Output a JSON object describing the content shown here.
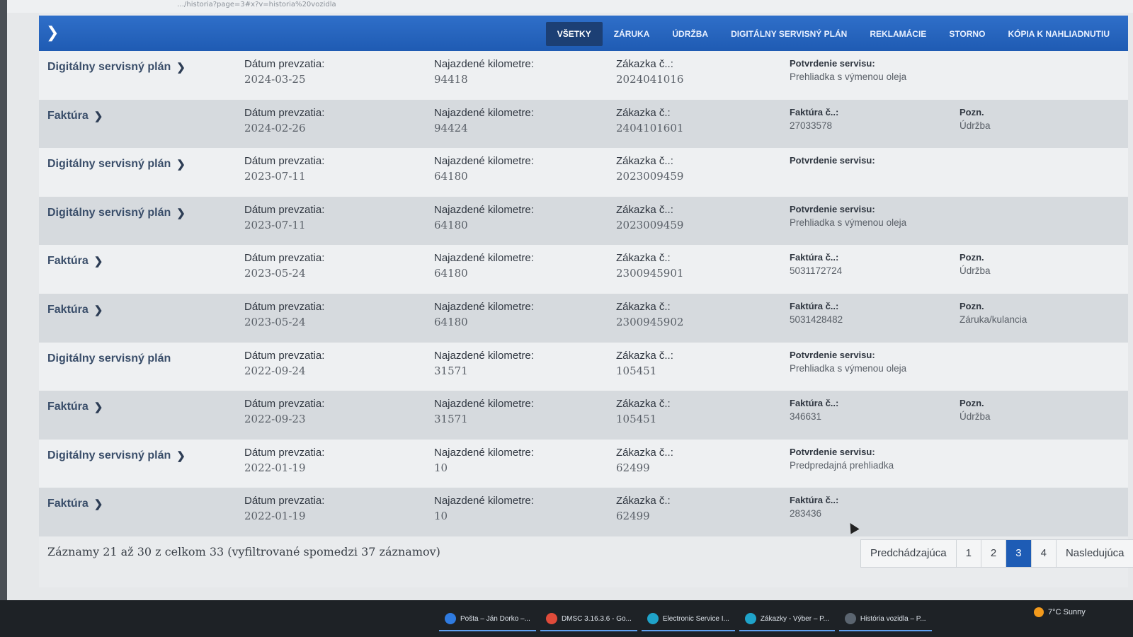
{
  "url": "…/historia?page=3#x?v=historia%20vozidla",
  "tabs": [
    "VŠETKY",
    "ZÁRUKA",
    "ÚDRŽBA",
    "DIGITÁLNY SERVISNÝ PLÁN",
    "REKLAMÁCIE",
    "STORNO",
    "KÓPIA K NAHLIADNUTIU"
  ],
  "labels": {
    "date": "Dátum prevzatia:",
    "km": "Najazdené kilometre:",
    "order": "Zákazka č.:",
    "order_alt": "Zákazka č..:",
    "confirm": "Potvrdenie servisu:",
    "invoice": "Faktúra č..:",
    "note": "Pozn."
  },
  "rows": [
    {
      "type": "Digitálny servisný plán",
      "chevron": true,
      "date": "2024-03-25",
      "km": "94418",
      "order_label": "Zákazka č..:",
      "order": "2024041016",
      "c4_label": "Potvrdenie servisu:",
      "c4_val": "Prehliadka s výmenou oleja",
      "note_label": "",
      "note": ""
    },
    {
      "type": "Faktúra",
      "chevron": true,
      "date": "2024-02-26",
      "km": "94424",
      "order_label": "Zákazka č.:",
      "order": "2404101601",
      "c4_label": "Faktúra č..:",
      "c4_val": "27033578",
      "note_label": "Pozn.",
      "note": "Údržba"
    },
    {
      "type": "Digitálny servisný plán",
      "chevron": true,
      "date": "2023-07-11",
      "km": "64180",
      "order_label": "Zákazka č..:",
      "order": "2023009459",
      "c4_label": "Potvrdenie servisu:",
      "c4_val": "",
      "note_label": "",
      "note": ""
    },
    {
      "type": "Digitálny servisný plán",
      "chevron": true,
      "date": "2023-07-11",
      "km": "64180",
      "order_label": "Zákazka č..:",
      "order": "2023009459",
      "c4_label": "Potvrdenie servisu:",
      "c4_val": "Prehliadka s výmenou oleja",
      "note_label": "",
      "note": ""
    },
    {
      "type": "Faktúra",
      "chevron": true,
      "date": "2023-05-24",
      "km": "64180",
      "order_label": "Zákazka č.:",
      "order": "2300945901",
      "c4_label": "Faktúra č..:",
      "c4_val": "5031172724",
      "note_label": "Pozn.",
      "note": "Údržba"
    },
    {
      "type": "Faktúra",
      "chevron": true,
      "date": "2023-05-24",
      "km": "64180",
      "order_label": "Zákazka č.:",
      "order": "2300945902",
      "c4_label": "Faktúra č..:",
      "c4_val": "5031428482",
      "note_label": "Pozn.",
      "note": "Záruka/kulancia"
    },
    {
      "type": "Digitálny servisný plán",
      "chevron": false,
      "date": "2022-09-24",
      "km": "31571",
      "order_label": "Zákazka č..:",
      "order": "105451",
      "c4_label": "Potvrdenie servisu:",
      "c4_val": "Prehliadka s výmenou oleja",
      "note_label": "",
      "note": ""
    },
    {
      "type": "Faktúra",
      "chevron": true,
      "date": "2022-09-23",
      "km": "31571",
      "order_label": "Zákazka č.:",
      "order": "105451",
      "c4_label": "Faktúra č..:",
      "c4_val": "346631",
      "note_label": "Pozn.",
      "note": "Údržba"
    },
    {
      "type": "Digitálny servisný plán",
      "chevron": true,
      "date": "2022-01-19",
      "km": "10",
      "order_label": "Zákazka č..:",
      "order": "62499",
      "c4_label": "Potvrdenie servisu:",
      "c4_val": "Predpredajná prehliadka",
      "note_label": "",
      "note": ""
    },
    {
      "type": "Faktúra",
      "chevron": true,
      "date": "2022-01-19",
      "km": "10",
      "order_label": "Zákazka č.:",
      "order": "62499",
      "c4_label": "Faktúra č..:",
      "c4_val": "283436",
      "note_label": "",
      "note": ""
    }
  ],
  "footer": {
    "records_text": "Záznamy 21 až 30 z celkom 33 (vyfiltrované spomedzi 37 záznamov)"
  },
  "pagination": {
    "prev": "Predchádzajúca",
    "pages": [
      "1",
      "2",
      "3",
      "4"
    ],
    "active": "3",
    "next": "Nasledujúca"
  },
  "taskbar": {
    "items": [
      {
        "label": "Pošta – Ján Dorko –...",
        "icon": "mail-icon",
        "color": "#2f7be0"
      },
      {
        "label": "DMSC 3.16.3.6 - Go...",
        "icon": "chrome-icon",
        "color": "#e04b3a"
      },
      {
        "label": "Electronic Service I...",
        "icon": "edge-icon",
        "color": "#1fa3c9"
      },
      {
        "label": "Zákazky - Výber – P...",
        "icon": "edge-icon",
        "color": "#1fa3c9"
      },
      {
        "label": "História vozidla – P...",
        "icon": "v-icon",
        "color": "#5b6570"
      }
    ],
    "weather": "7°C  Sunny"
  }
}
